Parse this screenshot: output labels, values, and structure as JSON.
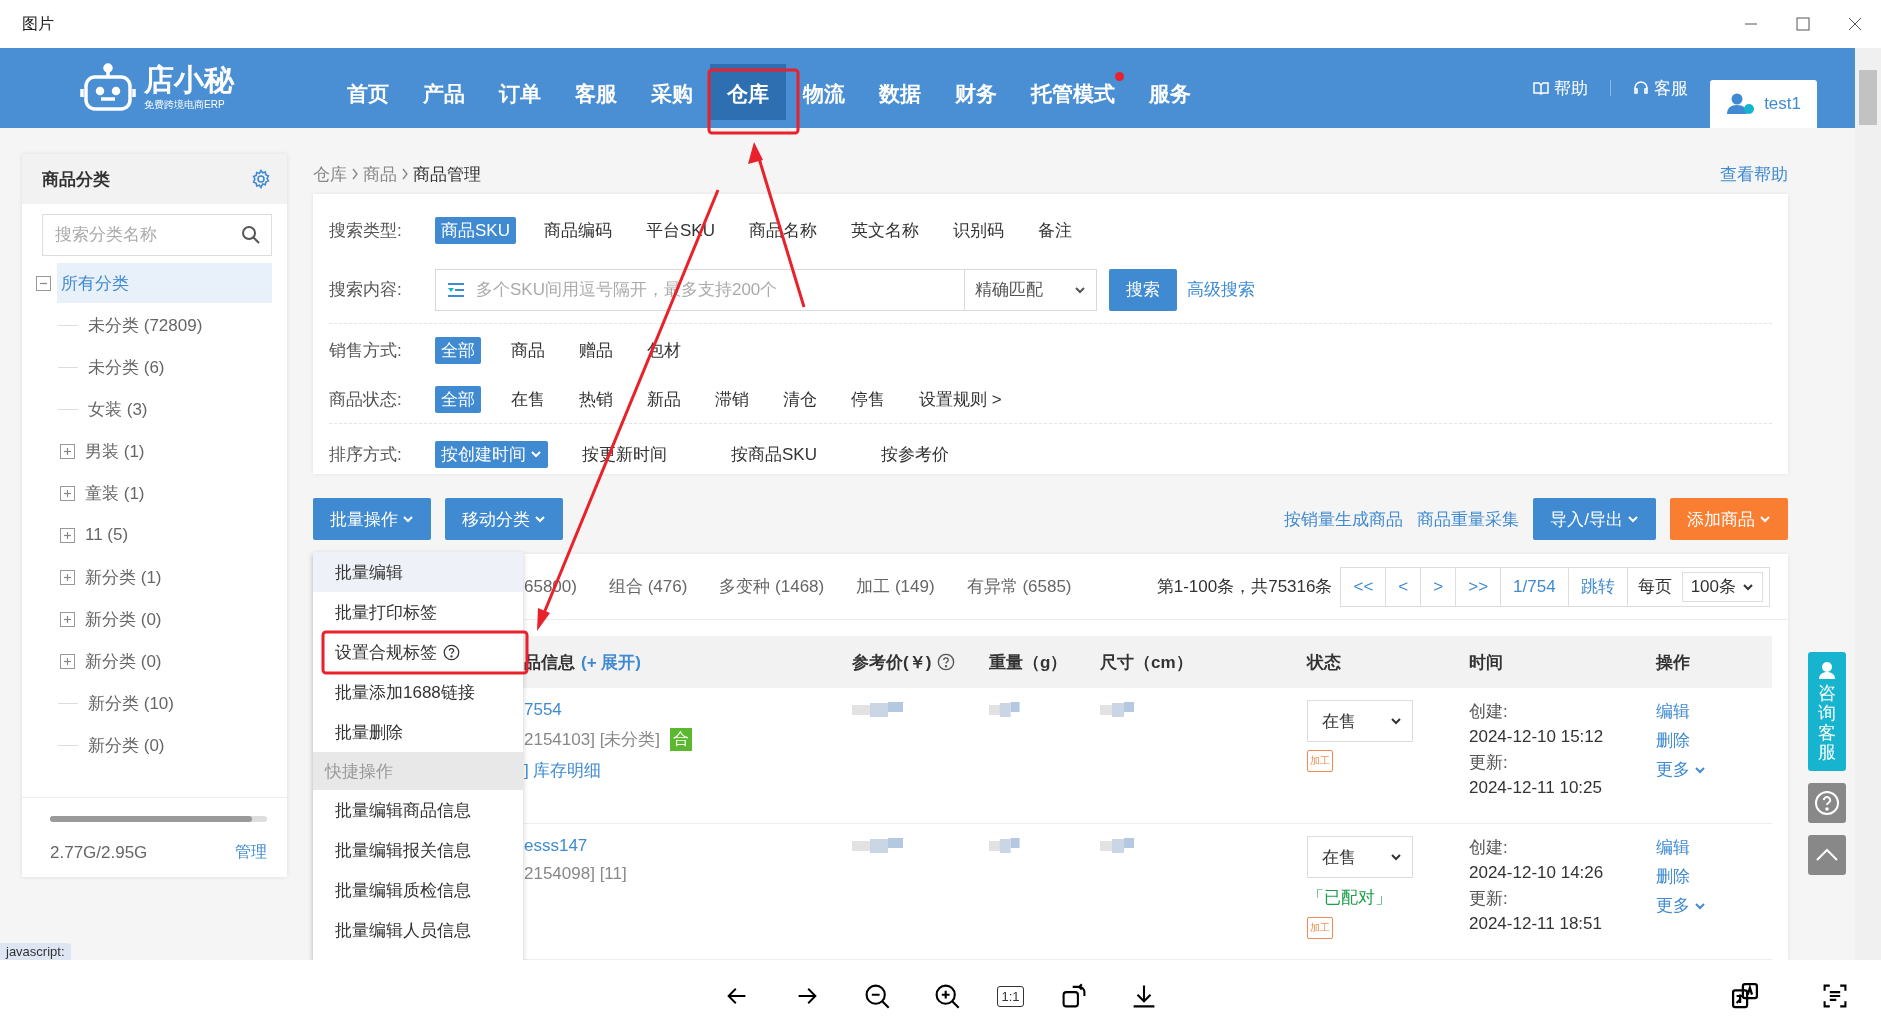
{
  "viewer": {
    "title": "图片",
    "actual_size": "1:1"
  },
  "nav": {
    "logo": {
      "name": "店小秘",
      "tagline": "免费跨境电商ERP"
    },
    "items": [
      {
        "label": "首页",
        "selected": false,
        "dot": false
      },
      {
        "label": "产品",
        "selected": false,
        "dot": false
      },
      {
        "label": "订单",
        "selected": false,
        "dot": false
      },
      {
        "label": "客服",
        "selected": false,
        "dot": false
      },
      {
        "label": "采购",
        "selected": false,
        "dot": false
      },
      {
        "label": "仓库",
        "selected": true,
        "dot": false
      },
      {
        "label": "物流",
        "selected": false,
        "dot": false
      },
      {
        "label": "数据",
        "selected": false,
        "dot": false
      },
      {
        "label": "财务",
        "selected": false,
        "dot": false
      },
      {
        "label": "托管模式",
        "selected": false,
        "dot": true
      },
      {
        "label": "服务",
        "selected": false,
        "dot": false
      }
    ],
    "help": "帮助",
    "service": "客服",
    "user": "test1"
  },
  "sidebar": {
    "title": "商品分类",
    "search_placeholder": "搜索分类名称",
    "tree": [
      {
        "label": "所有分类",
        "kind": "folder",
        "expanded": true,
        "selected": true,
        "children": [
          {
            "label": "未分类 (72809)",
            "kind": "leaf",
            "selected": false
          },
          {
            "label": "未分类 (6)",
            "kind": "leaf",
            "selected": false
          },
          {
            "label": "女装 (3)",
            "kind": "leaf",
            "selected": false
          },
          {
            "label": "男装 (1)",
            "kind": "folder",
            "expanded": false,
            "selected": false
          },
          {
            "label": "童装 (1)",
            "kind": "folder",
            "expanded": false,
            "selected": false
          },
          {
            "label": "11 (5)",
            "kind": "folder",
            "expanded": false,
            "selected": false
          },
          {
            "label": "新分类 (1)",
            "kind": "folder",
            "expanded": false,
            "selected": false
          },
          {
            "label": "新分类 (0)",
            "kind": "folder",
            "expanded": false,
            "selected": false
          },
          {
            "label": "新分类 (0)",
            "kind": "folder",
            "expanded": false,
            "selected": false
          },
          {
            "label": "新分类 (10)",
            "kind": "leaf",
            "selected": false
          },
          {
            "label": "新分类 (0)",
            "kind": "leaf",
            "selected": false
          }
        ]
      }
    ],
    "storage": {
      "text": "2.77G/2.95G",
      "level": 0.93,
      "manage": "管理"
    }
  },
  "breadcrumb": [
    "仓库",
    "商品",
    "商品管理"
  ],
  "help_link": "查看帮助",
  "filters": [
    {
      "kind": "options",
      "label": "搜索类型:",
      "options": [
        {
          "label": "商品SKU",
          "selected": true
        },
        {
          "label": "商品编码",
          "selected": false
        },
        {
          "label": "平台SKU",
          "selected": false
        },
        {
          "label": "商品名称",
          "selected": false
        },
        {
          "label": "英文名称",
          "selected": false
        },
        {
          "label": "识别码",
          "selected": false
        },
        {
          "label": "备注",
          "selected": false
        }
      ]
    },
    {
      "kind": "search",
      "label": "搜索内容:",
      "placeholder": "多个SKU间用逗号隔开，最多支持200个",
      "match": "精确匹配",
      "button": "搜索",
      "advanced": "高级搜索"
    },
    {
      "kind": "options",
      "label": "销售方式:",
      "options": [
        {
          "label": "全部",
          "selected": true
        },
        {
          "label": "商品",
          "selected": false
        },
        {
          "label": "赠品",
          "selected": false
        },
        {
          "label": "包材",
          "selected": false
        }
      ]
    },
    {
      "kind": "options",
      "label": "商品状态:",
      "options": [
        {
          "label": "全部",
          "selected": true
        },
        {
          "label": "在售",
          "selected": false
        },
        {
          "label": "热销",
          "selected": false
        },
        {
          "label": "新品",
          "selected": false
        },
        {
          "label": "滞销",
          "selected": false
        },
        {
          "label": "清仓",
          "selected": false
        },
        {
          "label": "停售",
          "selected": false
        }
      ],
      "extra": "设置规则 >"
    },
    {
      "kind": "sort",
      "label": "排序方式:",
      "options": [
        {
          "label": "按创建时间",
          "selected": true
        },
        {
          "label": "按更新时间",
          "selected": false
        },
        {
          "label": "按商品SKU",
          "selected": false
        },
        {
          "label": "按参考价",
          "selected": false
        }
      ]
    }
  ],
  "toolbar": {
    "batch": "批量操作",
    "move": "移动分类",
    "links": [
      "按销量生成商品",
      "商品重量采集"
    ],
    "import": "导入/导出",
    "add": "添加商品"
  },
  "menu": [
    {
      "kind": "item",
      "label": "批量编辑",
      "selected": true
    },
    {
      "kind": "item",
      "label": "批量打印标签",
      "selected": false
    },
    {
      "kind": "item",
      "label": "设置合规标签",
      "selected": false,
      "help": true
    },
    {
      "kind": "item",
      "label": "批量添加1688链接",
      "selected": false
    },
    {
      "kind": "item",
      "label": "批量删除",
      "selected": false
    },
    {
      "kind": "header",
      "label": "快捷操作"
    },
    {
      "kind": "item",
      "label": "批量编辑商品信息",
      "selected": false
    },
    {
      "kind": "item",
      "label": "批量编辑报关信息",
      "selected": false
    },
    {
      "kind": "item",
      "label": "批量编辑质检信息",
      "selected": false
    },
    {
      "kind": "item",
      "label": "批量编辑人员信息",
      "selected": false
    }
  ],
  "tabs": [
    "65800)",
    "组合 (476)",
    "多变种 (1468)",
    "加工 (149)",
    "有异常 (6585)"
  ],
  "pagination": {
    "summary": "第1-100条，共75316条",
    "buttons": [
      "<<",
      "<",
      ">",
      ">>"
    ],
    "page": "1/754",
    "jump": "跳转",
    "per_page_label": "每页",
    "per_page": "100条"
  },
  "table": {
    "columns": [
      {
        "label": "品信息",
        "extra": "(+ 展开)"
      },
      {
        "label": "参考价(￥)",
        "help": true
      },
      {
        "label": "重量（g）"
      },
      {
        "label": "尺寸（cm）"
      },
      {
        "label": "状态"
      },
      {
        "label": "时间"
      },
      {
        "label": "操作"
      }
    ],
    "rows": [
      {
        "sku": "7554",
        "info": "2154103] [未分类]",
        "badge": "合",
        "link": "] 库存明细",
        "status": "在售",
        "tag": "加工",
        "created_label": "创建:",
        "created": "2024-12-10 15:12",
        "updated_label": "更新:",
        "updated": "2024-12-11 10:25",
        "actions": [
          "编辑",
          "删除",
          "更多"
        ]
      },
      {
        "sku": "esss147",
        "info": "2154098] [11]",
        "status": "在售",
        "paired": "「已配对」",
        "tag": "加工",
        "created_label": "创建:",
        "created": "2024-12-10 14:26",
        "updated_label": "更新:",
        "updated": "2024-12-11 18:51",
        "actions": [
          "编辑",
          "删除",
          "更多"
        ]
      }
    ]
  },
  "consult": "咨询客服",
  "status_tip": "javascript:"
}
